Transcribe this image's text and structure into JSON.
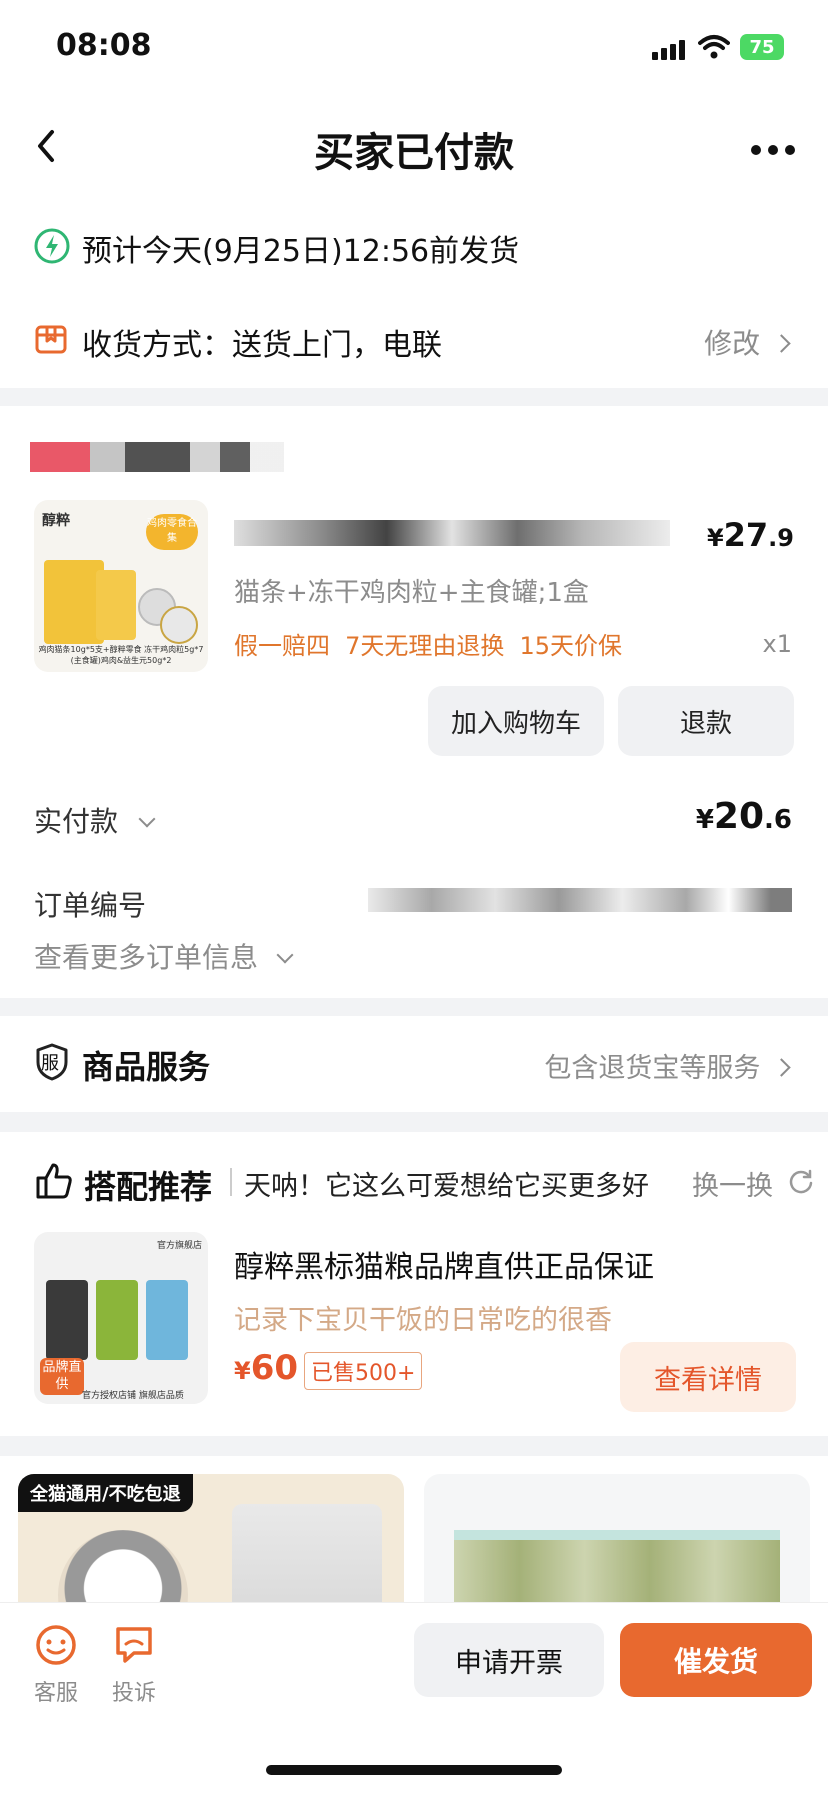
{
  "status_bar": {
    "time": "08:08",
    "battery": "75"
  },
  "header": {
    "title": "买家已付款"
  },
  "shipping": {
    "estimate": "预计今天(9月25日)12:56前发货"
  },
  "delivery": {
    "label": "收货方式：送货上门，电联",
    "action": "修改"
  },
  "order_item": {
    "variant": "猫条+冻干鸡肉粒+主食罐;1盒",
    "tags": [
      "假一赔四",
      "7天无理由退换",
      "15天价保"
    ],
    "price_int": "27",
    "price_dec": ".9",
    "currency": "¥",
    "quantity": "x1",
    "add_cart": "加入购物车",
    "refund": "退款",
    "image_caption": "鸡肉猫条10g*5支+醇粹零食 冻干鸡肉粒5g*7 (主食罐)鸡肉&益生元50g*2",
    "image_badge": "鸡肉零食合集",
    "brand_logo": "醇粹"
  },
  "payment": {
    "label": "实付款",
    "currency": "¥",
    "amount_int": "20",
    "amount_dec": ".6"
  },
  "order_info": {
    "id_label": "订单编号",
    "more": "查看更多订单信息"
  },
  "service": {
    "icon_char": "服",
    "title": "商品服务",
    "desc": "包含退货宝等服务"
  },
  "recommend": {
    "title": "搭配推荐",
    "slogan": "天呐！它这么可爱想给它买更多好",
    "refresh": "换一换",
    "product_title": "醇粹黑标猫粮品牌直供正品保证",
    "product_sub": "记录下宝贝干饭的日常吃的很香",
    "currency": "¥",
    "price": "60",
    "sold": "已售500+",
    "cta": "查看详情",
    "img_badge": "品牌直供",
    "img_store": "官方旗舰店",
    "img_footer": "官方授权店铺 旗舰店品质"
  },
  "feed": {
    "card1_banner": "全猫通用/不吃包退"
  },
  "bottom_bar": {
    "service": "客服",
    "complaint": "投诉",
    "invoice": "申请开票",
    "urge": "催发货"
  },
  "colors": {
    "accent": "#e8692f",
    "tag": "#e0762c",
    "urge_bg": "#e8692f",
    "green": "#2fb673"
  }
}
